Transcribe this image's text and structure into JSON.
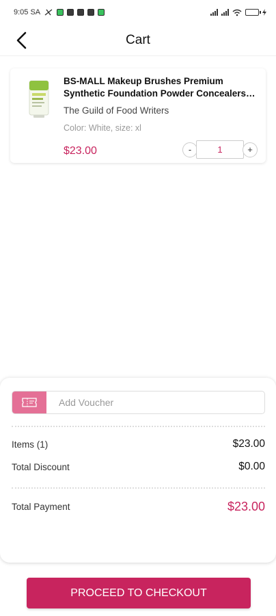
{
  "status_bar": {
    "time": "9:05 SA"
  },
  "header": {
    "title": "Cart"
  },
  "cart": {
    "items": [
      {
        "name": "BS-MALL Makeup Brushes Premium Synthetic Foundation Powder Concealers Eye Shadows Makeup Brush Sets",
        "store": "The Guild of Food Writers",
        "variant": "Color: White, size: xl",
        "price": "$23.00",
        "quantity": "1",
        "minus_label": "-",
        "plus_label": "+"
      }
    ]
  },
  "voucher": {
    "placeholder": "Add Voucher"
  },
  "summary": {
    "items_label": "Items (1)",
    "items_value": "$23.00",
    "discount_label": "Total Discount",
    "discount_value": "$0.00",
    "total_label": "Total Payment",
    "total_value": "$23.00"
  },
  "checkout": {
    "label": "PROCEED TO CHECKOUT"
  },
  "colors": {
    "accent": "#c8245e",
    "voucher_accent": "#e47096"
  }
}
